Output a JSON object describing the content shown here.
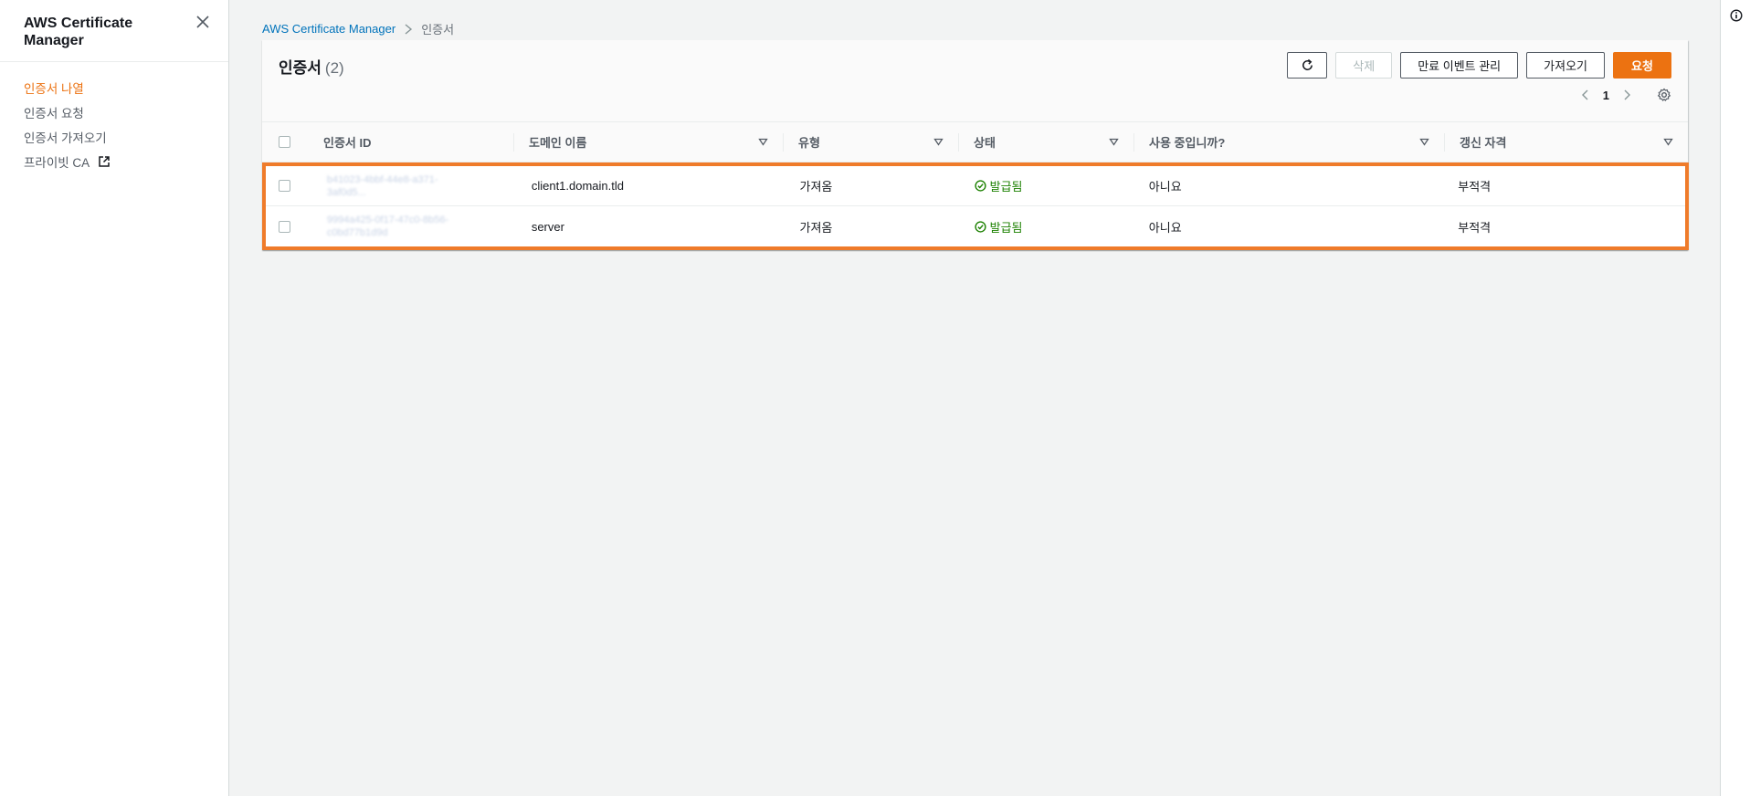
{
  "sidebar": {
    "title": "AWS Certificate Manager",
    "items": [
      {
        "label": "인증서 나열",
        "active": true
      },
      {
        "label": "인증서 요청"
      },
      {
        "label": "인증서 가져오기"
      },
      {
        "label": "프라이빗 CA",
        "external": true
      }
    ]
  },
  "breadcrumb": {
    "root": "AWS Certificate Manager",
    "current": "인증서"
  },
  "certificates": {
    "title": "인증서",
    "count": "(2)",
    "actions": {
      "delete": "삭제",
      "manage_expiry": "만료 이벤트 관리",
      "import": "가져오기",
      "request": "요청"
    },
    "pager": {
      "page": "1"
    },
    "columns": {
      "id": "인증서 ID",
      "domain": "도메인 이름",
      "type": "유형",
      "status": "상태",
      "in_use": "사용 중입니까?",
      "renewal": "갱신 자격"
    },
    "rows": [
      {
        "id_line1": "b41023-4bbf-44e8-a371-",
        "id_line2": "3af0d5...",
        "domain": "client1.domain.tld",
        "type": "가져옴",
        "status": "발급됨",
        "in_use": "아니요",
        "renewal": "부적격"
      },
      {
        "id_line1": "9994a425-0f17-47c0-8b56-",
        "id_line2": "c0bd77b1d9d",
        "domain": "server",
        "type": "가져옴",
        "status": "발급됨",
        "in_use": "아니요",
        "renewal": "부적격"
      }
    ]
  },
  "colors": {
    "accent": "#ec7211",
    "link": "#0073bb",
    "success": "#1d8102",
    "highlight": "#ef7b2a"
  }
}
